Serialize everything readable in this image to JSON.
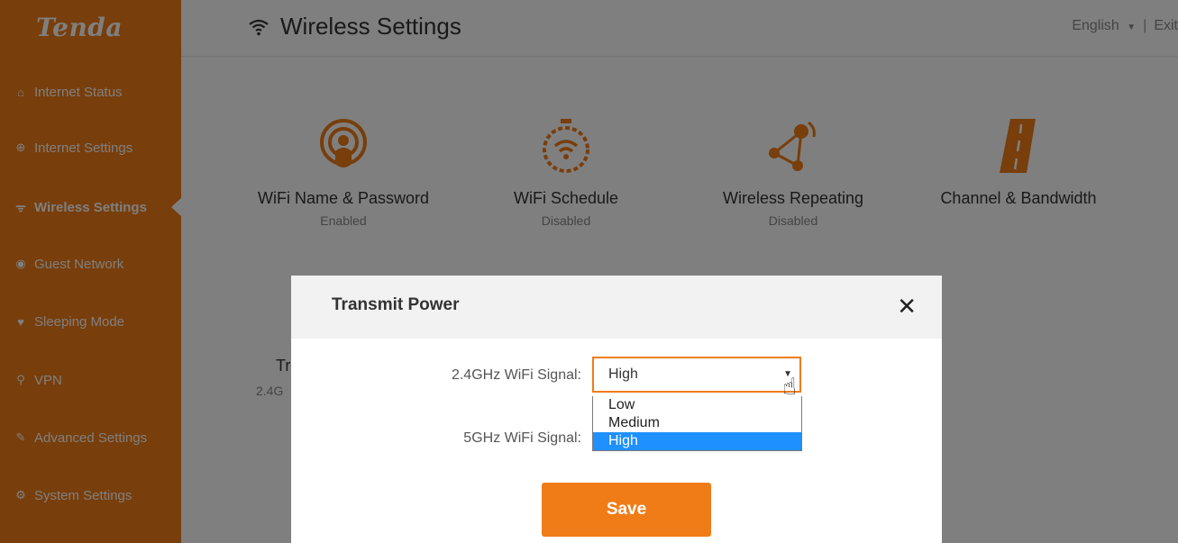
{
  "brand": {
    "logo_text": "Tenda",
    "accent_color": "#f07c17"
  },
  "sidebar": {
    "items": [
      {
        "label": "Internet Status",
        "icon": "router-icon",
        "glyph": "⌂"
      },
      {
        "label": "Internet Settings",
        "icon": "globe-icon",
        "glyph": "⊕"
      },
      {
        "label": "Wireless Settings",
        "icon": "wifi-icon",
        "glyph": "ᯤ"
      },
      {
        "label": "Guest Network",
        "icon": "guest-icon",
        "glyph": "◉"
      },
      {
        "label": "Sleeping Mode",
        "icon": "bulb-icon",
        "glyph": "♥"
      },
      {
        "label": "VPN",
        "icon": "vpn-icon",
        "glyph": "⚲"
      },
      {
        "label": "Advanced Settings",
        "icon": "tools-icon",
        "glyph": "✎"
      },
      {
        "label": "System Settings",
        "icon": "gear-icon",
        "glyph": "⚙"
      }
    ]
  },
  "header": {
    "title": "Wireless Settings",
    "language": "English",
    "separator": "|",
    "exit": "Exit"
  },
  "tiles": [
    {
      "title": "WiFi Name & Password",
      "status": "Enabled",
      "icon": "wifi-password-icon"
    },
    {
      "title": "WiFi Schedule",
      "status": "Disabled",
      "icon": "wifi-schedule-icon"
    },
    {
      "title": "Wireless Repeating",
      "status": "Disabled",
      "icon": "wireless-repeating-icon"
    },
    {
      "title": "Channel & Bandwidth",
      "status": "",
      "icon": "channel-bandwidth-icon"
    }
  ],
  "partial_tile": {
    "title_fragment": "Tr",
    "sub_fragment": "2.4G"
  },
  "modal": {
    "title": "Transmit Power",
    "close_glyph": "✕",
    "field_24": {
      "label": "2.4GHz WiFi Signal:",
      "value": "High"
    },
    "field_5": {
      "label": "5GHz WiFi Signal:"
    },
    "dropdown": {
      "options": [
        "Low",
        "Medium",
        "High"
      ],
      "selected": "High"
    },
    "save_label": "Save"
  }
}
